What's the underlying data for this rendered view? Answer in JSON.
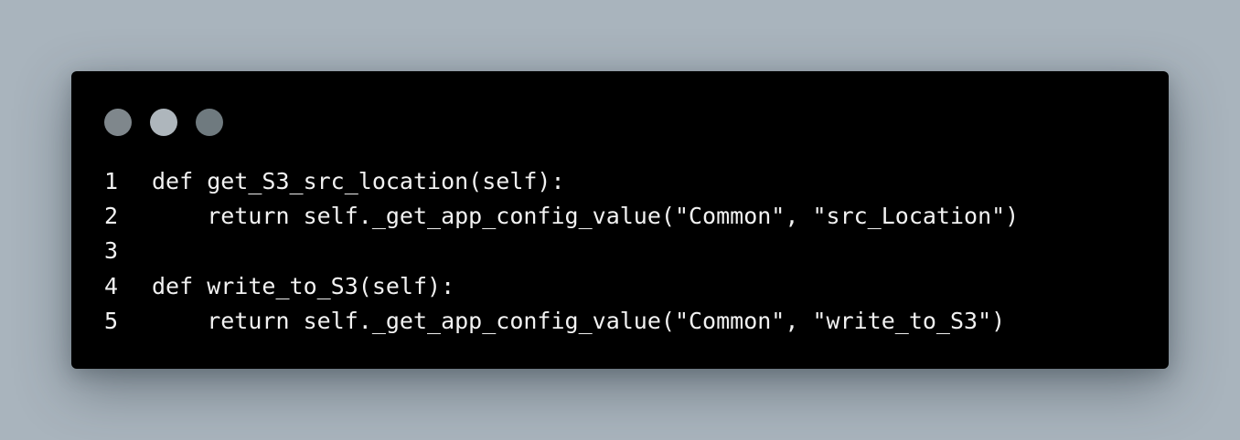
{
  "window": {
    "dots": [
      {
        "name": "dot-1",
        "color": "#7f878c"
      },
      {
        "name": "dot-2",
        "color": "#aeb6bc"
      },
      {
        "name": "dot-3",
        "color": "#6f7a7f"
      }
    ]
  },
  "code": {
    "lines": [
      {
        "number": "1",
        "text": "def get_S3_src_location(self):"
      },
      {
        "number": "2",
        "text": "    return self._get_app_config_value(\"Common\", \"src_Location\")"
      },
      {
        "number": "3",
        "text": ""
      },
      {
        "number": "4",
        "text": "def write_to_S3(self):"
      },
      {
        "number": "5",
        "text": "    return self._get_app_config_value(\"Common\", \"write_to_S3\")"
      }
    ]
  },
  "colors": {
    "page_background": "#a9b4bd",
    "window_background": "#000000",
    "code_text": "#f2f2f2"
  }
}
